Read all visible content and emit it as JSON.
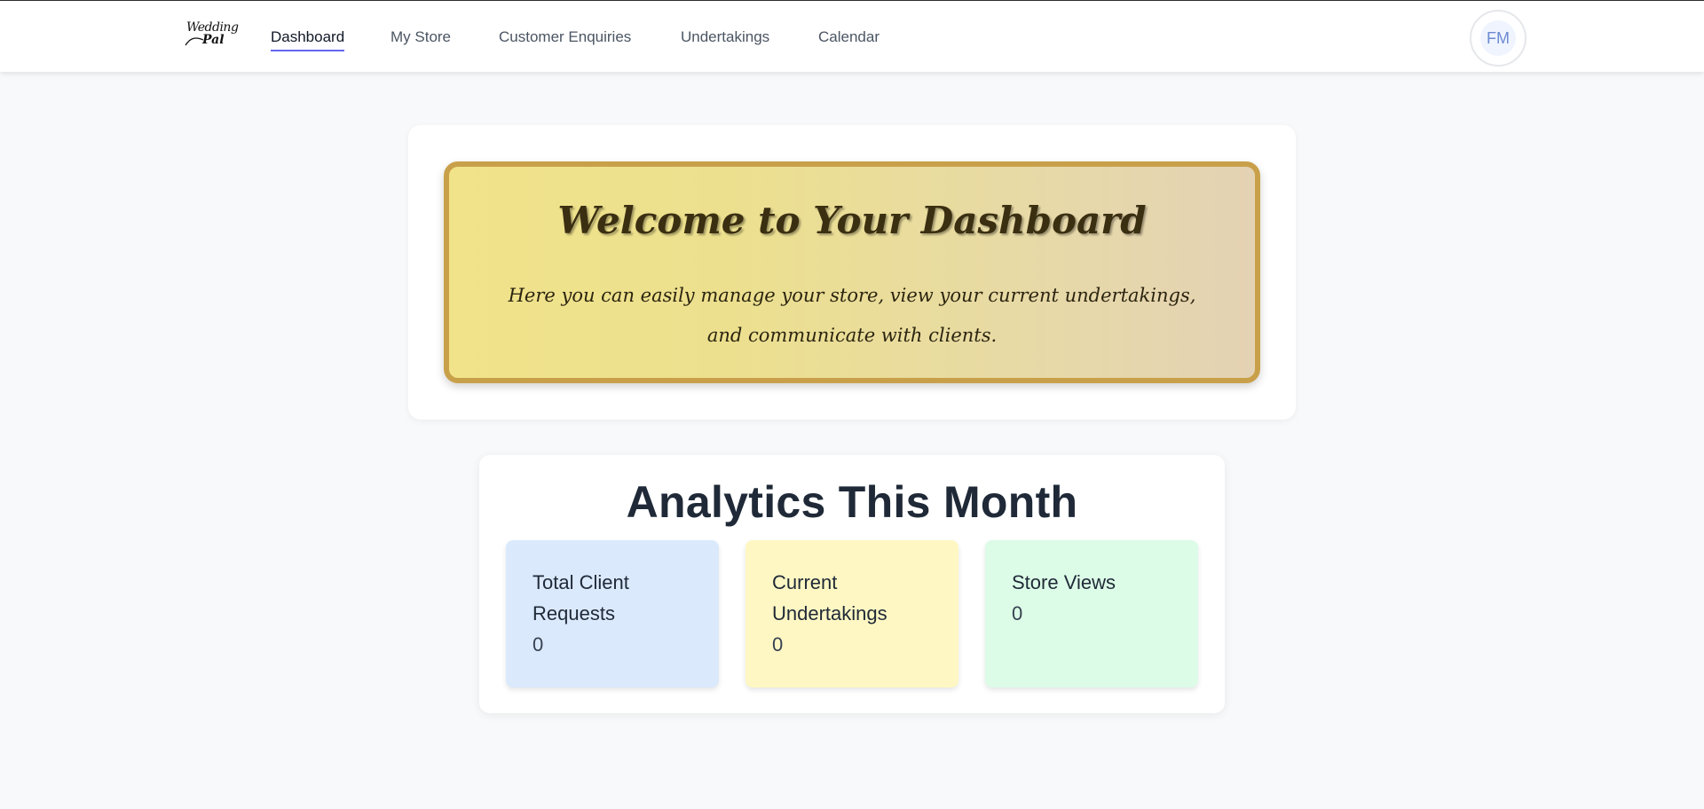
{
  "app": {
    "logo_line1": "Wedding",
    "logo_line2": "Pal"
  },
  "nav": {
    "items": [
      {
        "label": "Dashboard",
        "active": true
      },
      {
        "label": "My Store",
        "active": false
      },
      {
        "label": "Customer Enquiries",
        "active": false
      },
      {
        "label": "Undertakings",
        "active": false
      },
      {
        "label": "Calendar",
        "active": false
      }
    ]
  },
  "user": {
    "initials": "FM"
  },
  "welcome": {
    "title": "Welcome to Your Dashboard",
    "text": "Here you can easily manage your store, view your current undertakings, and communicate with clients."
  },
  "analytics": {
    "title": "Analytics This Month",
    "stats": [
      {
        "label": "Total Client Requests",
        "value": "0",
        "color": "#dbe9fd"
      },
      {
        "label": "Current Undertakings",
        "value": "0",
        "color": "#fef7c3"
      },
      {
        "label": "Store Views",
        "value": "0",
        "color": "#dcfce7"
      }
    ]
  },
  "colors": {
    "accent": "#6366f1",
    "banner_border": "#c9a04a"
  }
}
